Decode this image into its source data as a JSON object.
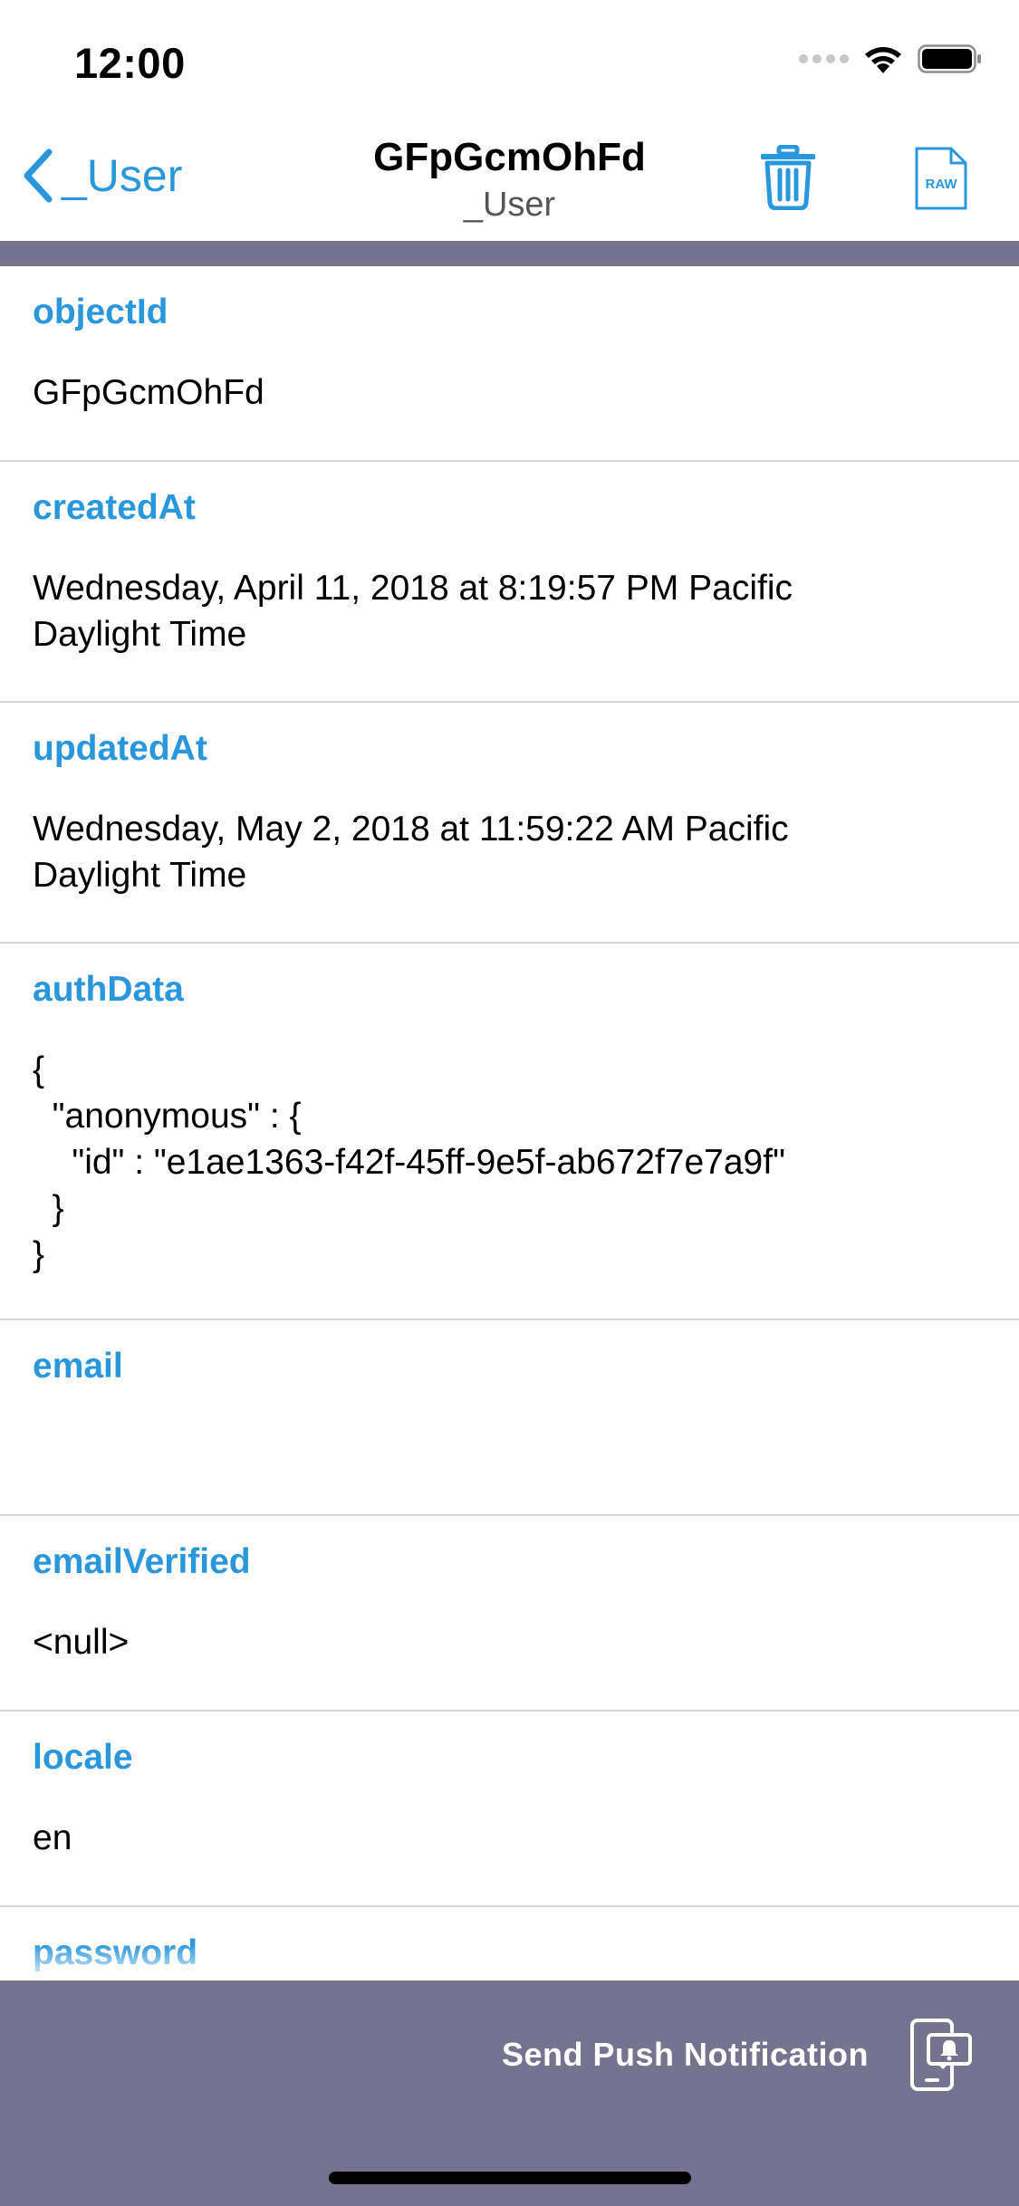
{
  "status_bar": {
    "time": "12:00"
  },
  "nav": {
    "back_label": "_User",
    "title": "GFpGcmOhFd",
    "subtitle": "_User",
    "raw_icon_text": "RAW"
  },
  "fields": [
    {
      "label": "objectId",
      "value": "GFpGcmOhFd"
    },
    {
      "label": "createdAt",
      "value": "Wednesday, April 11, 2018 at 8:19:57 PM Pacific\nDaylight Time"
    },
    {
      "label": "updatedAt",
      "value": "Wednesday, May 2, 2018 at 11:59:22 AM Pacific\nDaylight Time"
    },
    {
      "label": "authData",
      "value": "{\n  \"anonymous\" : {\n    \"id\" : \"e1ae1363-f42f-45ff-9e5f-ab672f7e7a9f\"\n  }\n}"
    },
    {
      "label": "email",
      "value": ""
    },
    {
      "label": "emailVerified",
      "value": "<null>"
    },
    {
      "label": "locale",
      "value": "en"
    },
    {
      "label": "password",
      "value": ""
    }
  ],
  "toolbar": {
    "push_label": "Send Push Notification"
  },
  "colors": {
    "accent": "#2a97dc",
    "toolbar": "#767390",
    "separator": "#d6d6d9"
  }
}
